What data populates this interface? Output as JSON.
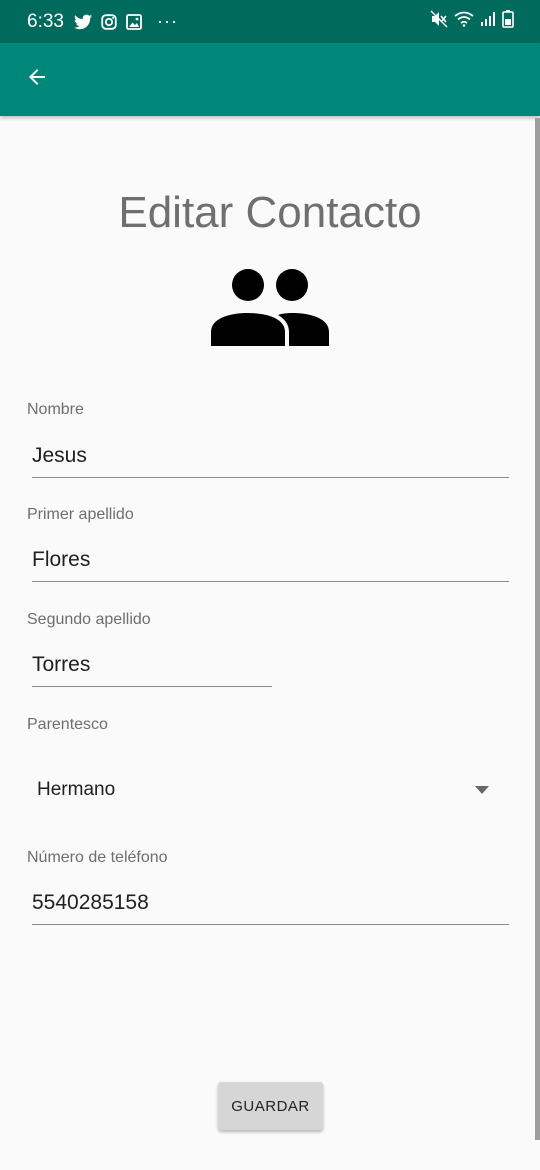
{
  "status_bar": {
    "time": "6:33",
    "left_icons": [
      "twitter-icon",
      "instagram-icon",
      "gallery-icon",
      "more-notifications-icon"
    ],
    "right_icons": [
      "mute-icon",
      "wifi-icon",
      "signal-icon",
      "battery-icon"
    ],
    "more_glyph": "···"
  },
  "app_bar": {
    "back_icon": "arrow-back-icon",
    "color": "#00877a",
    "status_color": "#006b5c"
  },
  "page": {
    "title": "Editar Contacto",
    "avatar_icon": "group-icon"
  },
  "form": {
    "nombre": {
      "label": "Nombre",
      "value": "Jesus"
    },
    "primer_apellido": {
      "label": "Primer apellido",
      "value": "Flores"
    },
    "segundo_apellido": {
      "label": "Segundo apellido",
      "value": "Torres"
    },
    "parentesco": {
      "label": "Parentesco",
      "selected": "Hermano"
    },
    "telefono": {
      "label": "Número de teléfono",
      "value": "5540285158"
    }
  },
  "actions": {
    "save_label": "GUARDAR"
  }
}
